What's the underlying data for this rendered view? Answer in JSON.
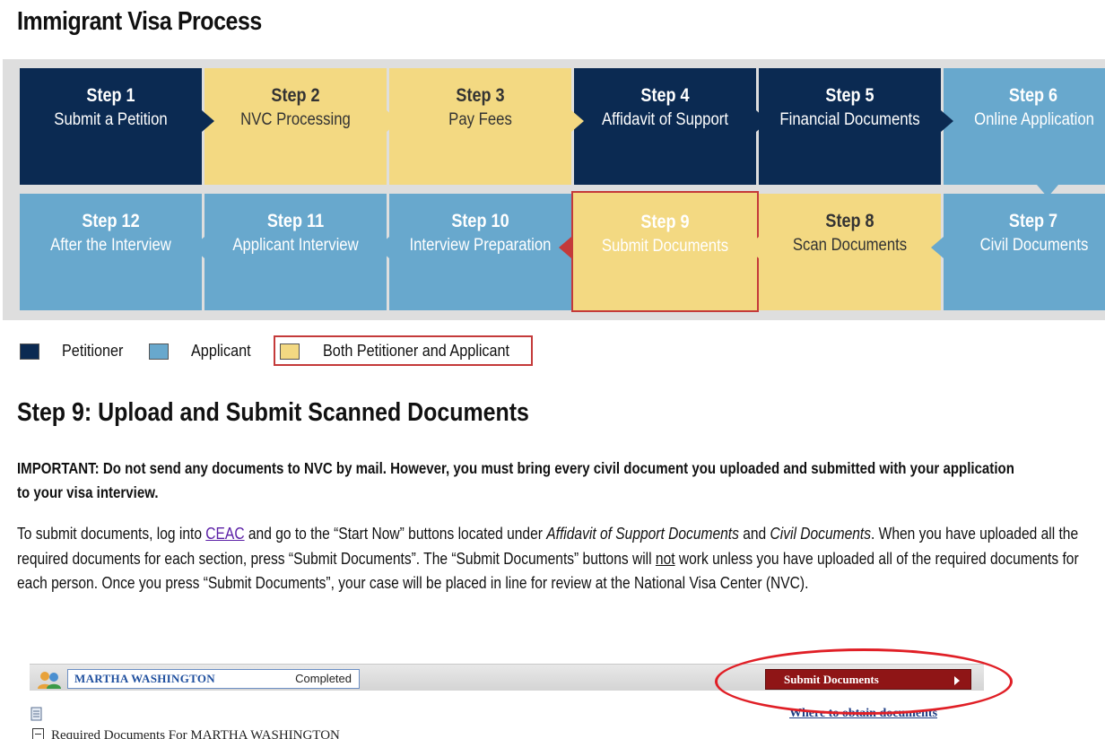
{
  "page": {
    "title": "Immigrant Visa Process"
  },
  "steps": [
    {
      "num": "Step 1",
      "name": "Submit a Petition",
      "role": "petitioner"
    },
    {
      "num": "Step 2",
      "name": "NVC Processing",
      "role": "both"
    },
    {
      "num": "Step 3",
      "name": "Pay Fees",
      "role": "both"
    },
    {
      "num": "Step 4",
      "name": "Affidavit of Support",
      "role": "petitioner"
    },
    {
      "num": "Step 5",
      "name": "Financial Documents",
      "role": "petitioner"
    },
    {
      "num": "Step 6",
      "name": "Online Application",
      "role": "applicant"
    },
    {
      "num": "Step 7",
      "name": "Civil Documents",
      "role": "applicant"
    },
    {
      "num": "Step 8",
      "name": "Scan Documents",
      "role": "both"
    },
    {
      "num": "Step 9",
      "name": "Submit Documents",
      "role": "both",
      "current": true
    },
    {
      "num": "Step 10",
      "name": "Interview Preparation",
      "role": "applicant"
    },
    {
      "num": "Step 11",
      "name": "Applicant Interview",
      "role": "applicant"
    },
    {
      "num": "Step 12",
      "name": "After the Interview",
      "role": "applicant"
    }
  ],
  "legend": {
    "petitioner": "Petitioner",
    "applicant": "Applicant",
    "both": "Both Petitioner and Applicant"
  },
  "colors": {
    "petitioner": "#0b2a52",
    "applicant": "#68a8cd",
    "both": "#f3d982",
    "highlight": "#c43a3a"
  },
  "section": {
    "title": "Step 9: Upload and Submit Scanned Documents",
    "important": "IMPORTANT: Do not send any documents to NVC by mail. However, you must bring every civil document you uploaded and submitted with your application to your visa interview.",
    "para_1": "To submit documents, log into ",
    "para_link": "CEAC",
    "para_2": " and go to the “Start Now” buttons located under ",
    "para_em_1": "Affidavit of Support Documents",
    "para_3": " and ",
    "para_em_2": "Civil Documents",
    "para_4": ". When you have uploaded all the required documents for each section, press “Submit Documents”. The “Submit Documents” buttons will ",
    "para_u": "not",
    "para_5": " work unless you have uploaded all of the required documents for each person. Once you press “Submit Documents”, your case will be placed in line for review at the National Visa Center (NVC)."
  },
  "screenshot": {
    "applicant_name": "MARTHA WASHINGTON",
    "status": "Completed",
    "submit_label": "Submit Documents",
    "where_link": "Where to obtain documents",
    "required_label": "Required Documents For MARTHA WASHINGTON",
    "icons": [
      "people-icon",
      "document-icon",
      "collapse-icon",
      "play-arrow-icon"
    ]
  }
}
